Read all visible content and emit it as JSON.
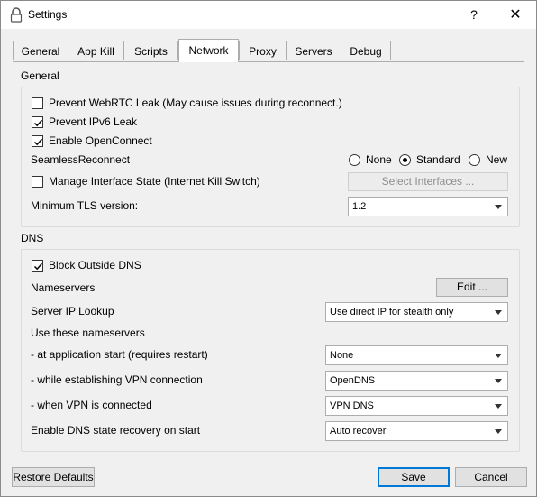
{
  "window": {
    "title": "Settings",
    "help_label": "?",
    "close_label": "✕"
  },
  "tabs": [
    {
      "label": "General"
    },
    {
      "label": "App Kill"
    },
    {
      "label": "Scripts"
    },
    {
      "label": "Network",
      "active": true
    },
    {
      "label": "Proxy"
    },
    {
      "label": "Servers"
    },
    {
      "label": "Debug"
    }
  ],
  "general": {
    "section_label": "General",
    "prevent_webrtc": {
      "label": "Prevent WebRTC Leak (May cause issues during reconnect.)",
      "checked": false
    },
    "prevent_ipv6": {
      "label": "Prevent IPv6 Leak",
      "checked": true
    },
    "enable_openconnect": {
      "label": "Enable OpenConnect",
      "checked": true
    },
    "seamless": {
      "label": "SeamlessReconnect",
      "options": [
        "None",
        "Standard",
        "New"
      ],
      "selected": "Standard"
    },
    "manage_interface": {
      "label": "Manage Interface State (Internet Kill Switch)",
      "checked": false
    },
    "select_interfaces_label": "Select Interfaces ...",
    "min_tls": {
      "label": "Minimum TLS version:",
      "value": "1.2"
    }
  },
  "dns": {
    "section_label": "DNS",
    "block_outside": {
      "label": "Block Outside DNS",
      "checked": true
    },
    "nameservers_label": "Nameservers",
    "edit_label": "Edit ...",
    "server_ip_lookup": {
      "label": "Server IP Lookup",
      "value": "Use direct IP for stealth only"
    },
    "use_these_label": "Use these nameservers",
    "at_start": {
      "label": " - at application start (requires restart)",
      "value": "None"
    },
    "while_establishing": {
      "label": " - while establishing VPN connection",
      "value": "OpenDNS"
    },
    "when_connected": {
      "label": " - when VPN is connected",
      "value": "VPN DNS"
    },
    "recovery": {
      "label": "Enable DNS state recovery on start",
      "value": "Auto recover"
    }
  },
  "footer": {
    "restore_label": "Restore Defaults",
    "save_label": "Save",
    "cancel_label": "Cancel"
  }
}
